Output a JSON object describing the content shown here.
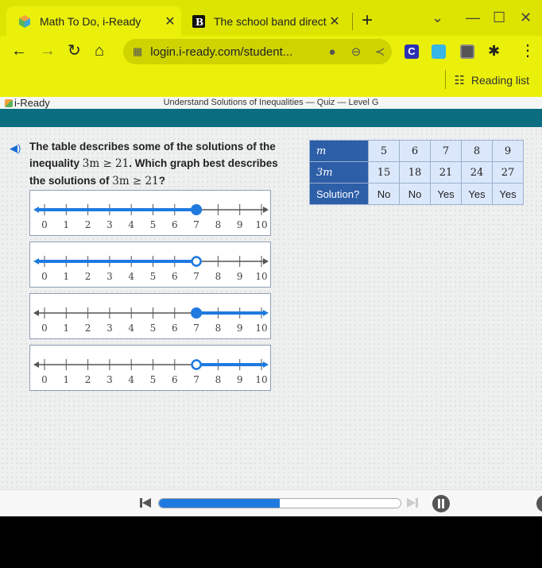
{
  "browser": {
    "tabs": [
      {
        "title": "Math To Do, i-Ready",
        "active": true,
        "icon": "iready-cube-icon"
      },
      {
        "title": "The school band director",
        "active": false,
        "icon": "brainly-b-icon"
      }
    ],
    "close_glyph": "✕",
    "new_tab_glyph": "+",
    "url": "login.i-ready.com/student...",
    "reading_list_label": "Reading list",
    "extensions": [
      {
        "name": "c-extension-icon",
        "color": "#2a2fb5"
      },
      {
        "name": "profile-extension-icon",
        "color": "#36b6e6"
      },
      {
        "name": "seal-extension-icon",
        "color": "#555555"
      }
    ]
  },
  "app": {
    "logo_text": "i-Ready",
    "lesson_title": "Understand Solutions of Inequalities — Quiz — Level G",
    "accent_color": "#1f7ae0",
    "teal_color": "#0a6e80"
  },
  "question": {
    "text_part1": "The table describes some of the solutions of the inequality ",
    "math1": "3m ≥ 21",
    "text_part2": ". Which graph best describes the solutions of ",
    "math2": "3m ≥ 21",
    "text_part3": "?"
  },
  "table": {
    "rows": [
      {
        "header": "m",
        "cells": [
          "5",
          "6",
          "7",
          "8",
          "9"
        ]
      },
      {
        "header": "3m",
        "cells": [
          "15",
          "18",
          "21",
          "24",
          "27"
        ]
      },
      {
        "header": "Solution?",
        "cells": [
          "No",
          "No",
          "Yes",
          "Yes",
          "Yes"
        ]
      }
    ]
  },
  "options": [
    {
      "id": "A",
      "point": 7,
      "closed": true,
      "direction": "left"
    },
    {
      "id": "B",
      "point": 7,
      "closed": false,
      "direction": "left"
    },
    {
      "id": "C",
      "point": 7,
      "closed": true,
      "direction": "right"
    },
    {
      "id": "D",
      "point": 7,
      "closed": false,
      "direction": "right"
    }
  ],
  "number_line": {
    "min": 0,
    "max": 10,
    "ticks": [
      "0",
      "1",
      "2",
      "3",
      "4",
      "5",
      "6",
      "7",
      "8",
      "9",
      "10"
    ]
  },
  "player": {
    "progress": 0.5
  }
}
